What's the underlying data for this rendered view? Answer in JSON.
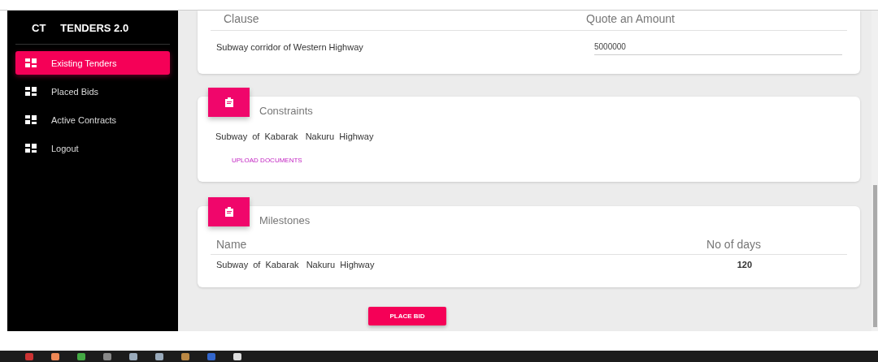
{
  "sidebar": {
    "brand_short": "CT",
    "brand": "TENDERS 2.0",
    "items": [
      {
        "label": "Existing Tenders",
        "selected": true
      },
      {
        "label": "Placed Bids",
        "selected": false
      },
      {
        "label": "Active Contracts",
        "selected": false
      },
      {
        "label": "Logout",
        "selected": false
      }
    ]
  },
  "clause_card": {
    "columns": [
      "Clause",
      "Quote an Amount"
    ],
    "row": {
      "clause": "Subway corridor of Western Highway",
      "amount": "5000000"
    }
  },
  "constraints_card": {
    "title": "Constraints",
    "text": "Subway  of  Kabarak   Nakuru  Highway",
    "upload_button": "UPLOAD DOCUMENTS"
  },
  "milestones_card": {
    "title": "Milestones",
    "columns": [
      "Name",
      "No of days"
    ],
    "rows": [
      {
        "name": "Subway  of  Kabarak   Nakuru  Highway",
        "days": "120"
      }
    ]
  },
  "place_bid_button": "PLACE BID"
}
